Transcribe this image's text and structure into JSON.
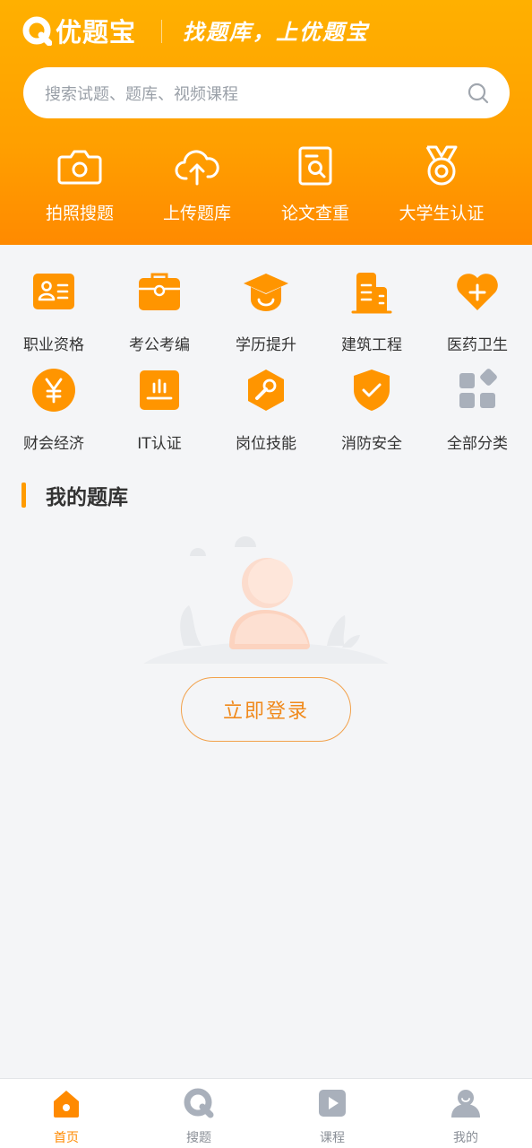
{
  "header": {
    "logo_text": "优题宝",
    "slogan": "找题库，上优题宝",
    "search_placeholder": "搜索试题、题库、视频课程",
    "actions": [
      {
        "label": "拍照搜题",
        "icon": "camera-icon"
      },
      {
        "label": "上传题库",
        "icon": "cloud-upload-icon"
      },
      {
        "label": "论文查重",
        "icon": "document-search-icon"
      },
      {
        "label": "大学生认证",
        "icon": "medal-icon"
      }
    ]
  },
  "categories": [
    {
      "label": "职业资格",
      "icon": "id-card-icon"
    },
    {
      "label": "考公考编",
      "icon": "briefcase-icon"
    },
    {
      "label": "学历提升",
      "icon": "graduation-cap-icon"
    },
    {
      "label": "建筑工程",
      "icon": "building-icon"
    },
    {
      "label": "医药卫生",
      "icon": "heart-plus-icon"
    },
    {
      "label": "财会经济",
      "icon": "yen-icon"
    },
    {
      "label": "IT认证",
      "icon": "monitor-icon"
    },
    {
      "label": "岗位技能",
      "icon": "wrench-icon"
    },
    {
      "label": "消防安全",
      "icon": "shield-check-icon"
    },
    {
      "label": "全部分类",
      "icon": "grid-icon"
    }
  ],
  "my_bank": {
    "title": "我的题库",
    "login_label": "立即登录"
  },
  "tabbar": [
    {
      "label": "首页",
      "icon": "home-icon",
      "active": true
    },
    {
      "label": "搜题",
      "icon": "search-tab-icon",
      "active": false
    },
    {
      "label": "课程",
      "icon": "play-icon",
      "active": false
    },
    {
      "label": "我的",
      "icon": "user-icon",
      "active": false
    }
  ],
  "colors": {
    "brand_orange": "#ff9f00",
    "icon_orange": "#ff9500",
    "tab_inactive": "#a9b0bb"
  }
}
